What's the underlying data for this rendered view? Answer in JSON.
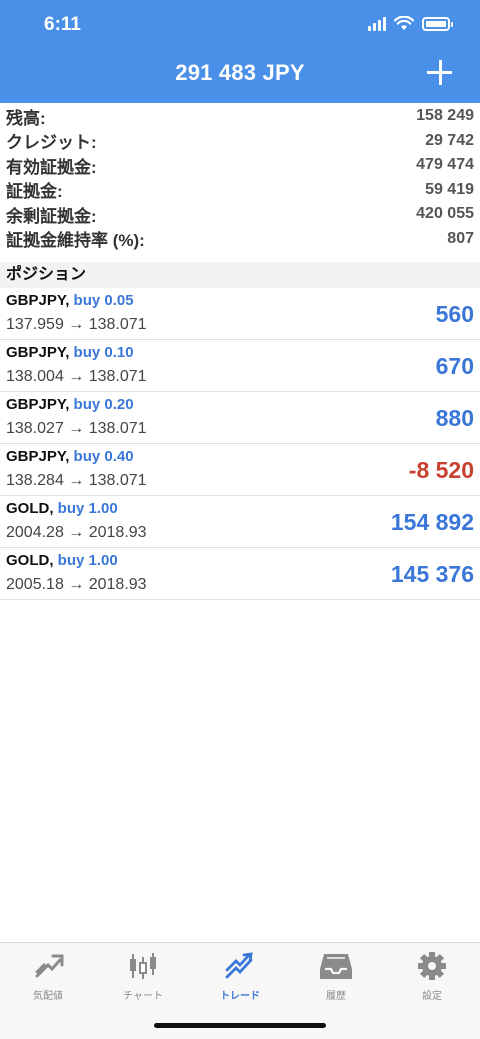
{
  "status": {
    "time": "6:11"
  },
  "header": {
    "title": "291 483 JPY"
  },
  "summary": [
    {
      "label": "残高:",
      "value": "158 249"
    },
    {
      "label": "クレジット:",
      "value": "29 742"
    },
    {
      "label": "有効証拠金:",
      "value": "479 474"
    },
    {
      "label": "証拠金:",
      "value": "59 419"
    },
    {
      "label": "余剰証拠金:",
      "value": "420 055"
    },
    {
      "label": "証拠金維持率 (%):",
      "value": "807"
    }
  ],
  "positions_title": "ポジション",
  "positions": [
    {
      "symbol": "GBPJPY,",
      "side": "buy 0.05",
      "prices": "137.959 → 138.071",
      "profit": "560"
    },
    {
      "symbol": "GBPJPY,",
      "side": "buy 0.10",
      "prices": "138.004 → 138.071",
      "profit": "670"
    },
    {
      "symbol": "GBPJPY,",
      "side": "buy 0.20",
      "prices": "138.027 → 138.071",
      "profit": "880"
    },
    {
      "symbol": "GBPJPY,",
      "side": "buy 0.40",
      "prices": "138.284 → 138.071",
      "profit": "-8 520"
    },
    {
      "symbol": "GOLD,",
      "side": "buy 1.00",
      "prices": "2004.28 → 2018.93",
      "profit": "154 892"
    },
    {
      "symbol": "GOLD,",
      "side": "buy 1.00",
      "prices": "2005.18 → 2018.93",
      "profit": "145 376"
    }
  ],
  "tabs": [
    {
      "label": "気配値",
      "icon": "quotes-icon"
    },
    {
      "label": "チャート",
      "icon": "chart-icon"
    },
    {
      "label": "トレード",
      "icon": "trade-icon",
      "active": true
    },
    {
      "label": "履歴",
      "icon": "history-icon"
    },
    {
      "label": "設定",
      "icon": "settings-icon"
    }
  ],
  "colors": {
    "header": "#4a90e8",
    "positive": "#3a77d8",
    "negative": "#c8412f"
  }
}
